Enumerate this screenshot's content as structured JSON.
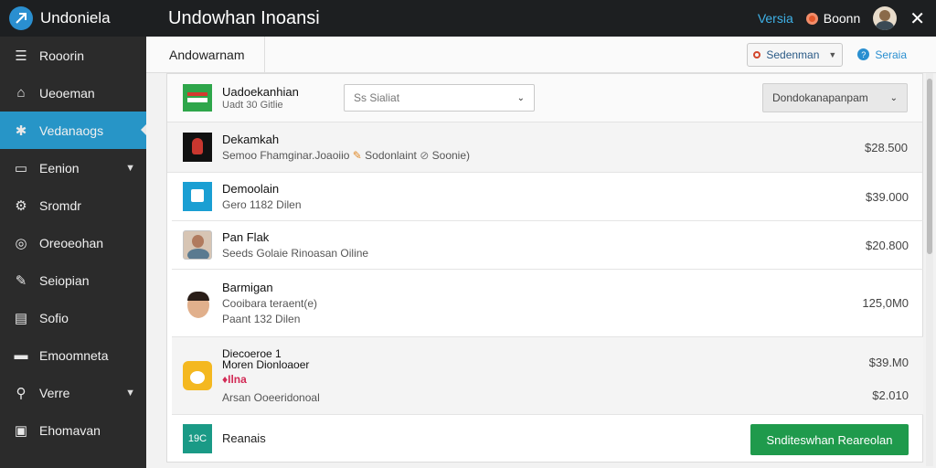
{
  "app": {
    "brand_name": "Undoniela",
    "window_title": "Undowhan Inoansi",
    "version_link": "Versia",
    "status_label": "Boonn"
  },
  "sidebar": {
    "items": [
      {
        "label": "Rooorin",
        "icon": "list-icon"
      },
      {
        "label": "Ueoeman",
        "icon": "home-icon"
      },
      {
        "label": "Vedanaogs",
        "icon": "puzzle-icon",
        "active": true
      },
      {
        "label": "Eenion",
        "icon": "card-icon",
        "chevron": true
      },
      {
        "label": "Sromdr",
        "icon": "settings-icon"
      },
      {
        "label": "Oreoeohan",
        "icon": "circle-icon"
      },
      {
        "label": "Seiopian",
        "icon": "wrench-icon"
      },
      {
        "label": "Sofio",
        "icon": "chart-icon"
      },
      {
        "label": "Emoomneta",
        "icon": "box-icon"
      },
      {
        "label": "Verre",
        "icon": "search-icon",
        "chevron": true
      },
      {
        "label": "Ehomavan",
        "icon": "image-icon"
      }
    ]
  },
  "header": {
    "section_label": "Andowarnam",
    "sort_label": "Sedenman",
    "help_label": "Seraia"
  },
  "filter": {
    "account_name": "Uadoekanhian",
    "account_sub": "U⁠a⁠d⁠t 30 Gitlie",
    "search_placeholder": "Ss Sialiat",
    "group_dropdown": "Dondokanapanpam"
  },
  "rows": [
    {
      "t1": "Dekamkah",
      "t2": "Semoo Fhamginar.Joaoiio",
      "t2b": "Sodonlaint",
      "t2c": "Soonie)",
      "amount": "$28.500",
      "thumb": "black"
    },
    {
      "t1": "Demoolain",
      "t2": "Gero 1182 Dilen",
      "amount": "$39.000",
      "thumb": "blue"
    },
    {
      "t1": "Pan Flak",
      "t2": "Seeds Golaie Rinoasan Oiline",
      "amount": "$20.800",
      "thumb": "person"
    },
    {
      "t1": "Barmigan",
      "t2": "Cooibara teraent(e)",
      "t3": "Paant 132 Dilen",
      "amount": "125,0M0",
      "thumb": "face"
    },
    {
      "t1": "Diecoeroe 1",
      "t1b": "Moren Dionloaoer",
      "t2": "Ilna",
      "t3": "Arsan Ooeeridonoal",
      "amount": "$39.M0",
      "amount2": "$2.010",
      "thumb": "yellow"
    }
  ],
  "bottom": {
    "badge": "19C",
    "label": "Reanais",
    "button_label": "Snditeswhan Reareolan"
  }
}
